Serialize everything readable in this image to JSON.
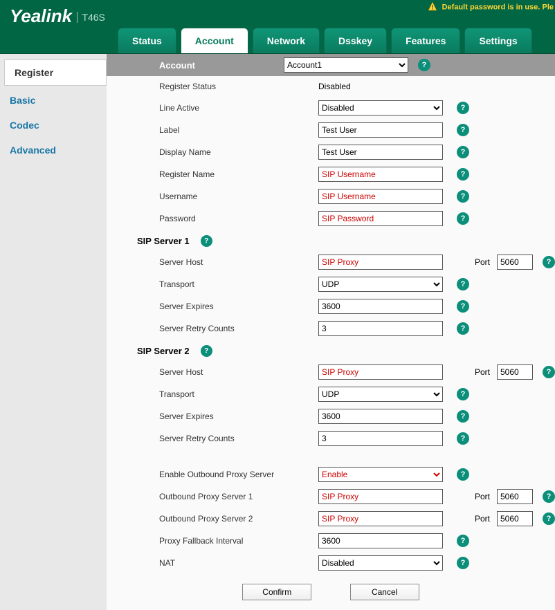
{
  "header": {
    "logo": "Yealink",
    "model": "T46S",
    "warning": "Default password is in use. Ple"
  },
  "tabs": [
    {
      "label": "Status",
      "active": false
    },
    {
      "label": "Account",
      "active": true
    },
    {
      "label": "Network",
      "active": false
    },
    {
      "label": "Dsskey",
      "active": false
    },
    {
      "label": "Features",
      "active": false
    },
    {
      "label": "Settings",
      "active": false
    }
  ],
  "sidebar": [
    {
      "label": "Register",
      "active": true
    },
    {
      "label": "Basic",
      "active": false
    },
    {
      "label": "Codec",
      "active": false
    },
    {
      "label": "Advanced",
      "active": false
    }
  ],
  "section": {
    "title": "Account",
    "account_select": "Account1"
  },
  "fields": {
    "register_status_label": "Register Status",
    "register_status_value": "Disabled",
    "line_active_label": "Line Active",
    "line_active_value": "Disabled",
    "label_label": "Label",
    "label_value": "Test User",
    "display_name_label": "Display Name",
    "display_name_value": "Test User",
    "register_name_label": "Register Name",
    "register_name_value": "SIP Username",
    "username_label": "Username",
    "username_value": "SIP Username",
    "password_label": "Password",
    "password_value": "SIP Password"
  },
  "sip_server1": {
    "title": "SIP Server 1",
    "server_host_label": "Server Host",
    "server_host_value": "SIP Proxy",
    "port_label": "Port",
    "port_value": "5060",
    "transport_label": "Transport",
    "transport_value": "UDP",
    "server_expires_label": "Server Expires",
    "server_expires_value": "3600",
    "retry_label": "Server Retry Counts",
    "retry_value": "3"
  },
  "sip_server2": {
    "title": "SIP Server 2",
    "server_host_label": "Server Host",
    "server_host_value": "SIP Proxy",
    "port_label": "Port",
    "port_value": "5060",
    "transport_label": "Transport",
    "transport_value": "UDP",
    "server_expires_label": "Server Expires",
    "server_expires_value": "3600",
    "retry_label": "Server Retry Counts",
    "retry_value": "3"
  },
  "outbound": {
    "enable_label": "Enable Outbound Proxy Server",
    "enable_value": "Enable",
    "server1_label": "Outbound Proxy Server 1",
    "server1_value": "SIP Proxy",
    "server1_port": "5060",
    "server2_label": "Outbound Proxy Server 2",
    "server2_value": "SIP Proxy",
    "server2_port": "5060",
    "fallback_label": "Proxy Fallback Interval",
    "fallback_value": "3600",
    "nat_label": "NAT",
    "nat_value": "Disabled",
    "port_label": "Port"
  },
  "buttons": {
    "confirm": "Confirm",
    "cancel": "Cancel"
  }
}
